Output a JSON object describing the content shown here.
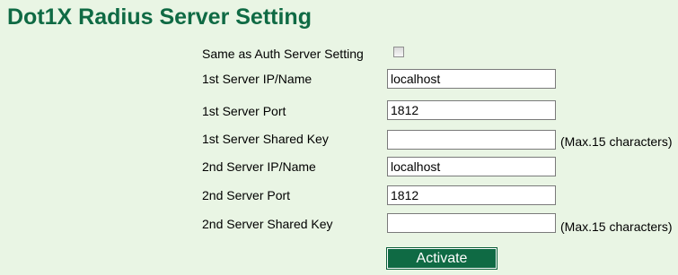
{
  "page": {
    "title": "Dot1X Radius Server Setting"
  },
  "form": {
    "same_as_auth": {
      "label": "Same as Auth Server Setting",
      "checked": false
    },
    "server1_ip": {
      "label": "1st Server IP/Name",
      "value": "localhost"
    },
    "server1_port": {
      "label": "1st Server Port",
      "value": "1812"
    },
    "server1_key": {
      "label": "1st Server Shared Key",
      "value": "",
      "hint": "(Max.15 characters)"
    },
    "server2_ip": {
      "label": "2nd Server IP/Name",
      "value": "localhost"
    },
    "server2_port": {
      "label": "2nd Server Port",
      "value": "1812"
    },
    "server2_key": {
      "label": "2nd Server Shared Key",
      "value": "",
      "hint": "(Max.15 characters)"
    }
  },
  "actions": {
    "activate_label": "Activate"
  },
  "colors": {
    "background": "#E9F5E4",
    "title": "#0F6A44",
    "button": "#0F6A44"
  }
}
